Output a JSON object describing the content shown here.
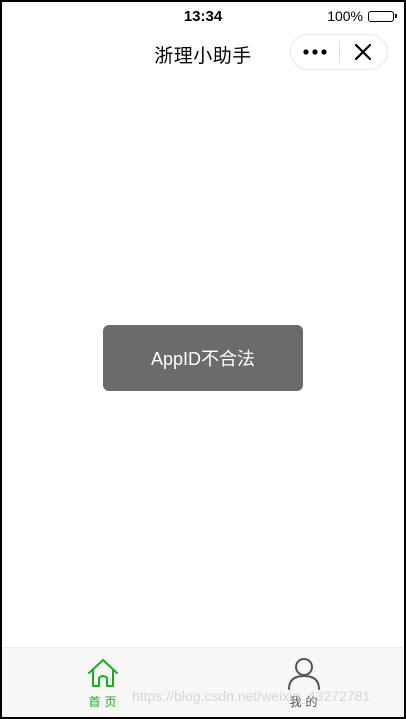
{
  "status_bar": {
    "time": "13:34",
    "battery_percent": "100%"
  },
  "nav_bar": {
    "title": "浙理小助手",
    "more_icon": "more-dots-icon",
    "close_icon": "close-icon"
  },
  "toast": {
    "message": "AppID不合法"
  },
  "tab_bar": {
    "tabs": [
      {
        "label": "首页",
        "icon": "home-icon",
        "active": true
      },
      {
        "label": "我的",
        "icon": "user-icon",
        "active": false
      }
    ],
    "active_color": "#1aad19",
    "inactive_color": "#555555"
  },
  "watermark": "https://blog.csdn.net/weixin_43272781"
}
